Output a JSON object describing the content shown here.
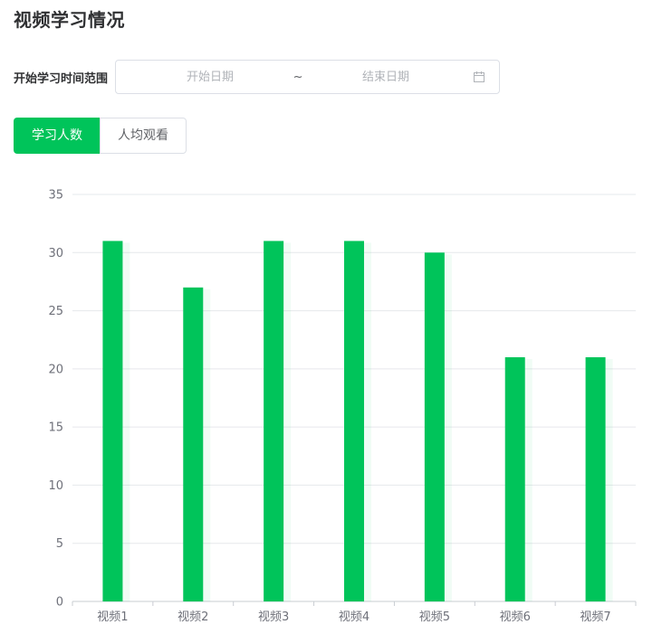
{
  "page": {
    "title": "视频学习情况"
  },
  "filter": {
    "label": "开始学习时间范围",
    "start_placeholder": "开始日期",
    "separator": "~",
    "end_placeholder": "结束日期",
    "icon": "calendar-icon"
  },
  "tabs": [
    {
      "label": "学习人数",
      "active": true
    },
    {
      "label": "人均观看",
      "active": false
    }
  ],
  "colors": {
    "accent": "#00c45a",
    "grid": "#e6e8ec",
    "axis": "#6e7079"
  },
  "chart_data": {
    "type": "bar",
    "categories": [
      "视频1",
      "视频2",
      "视频3",
      "视频4",
      "视频5",
      "视频6",
      "视频7"
    ],
    "values": [
      31,
      27,
      31,
      31,
      30,
      21,
      21
    ],
    "ylim": [
      0,
      35
    ],
    "yticks": [
      0,
      5,
      10,
      15,
      20,
      25,
      30,
      35
    ],
    "title": "",
    "xlabel": "",
    "ylabel": "",
    "grid": true,
    "bar_color": "#00c45a"
  }
}
